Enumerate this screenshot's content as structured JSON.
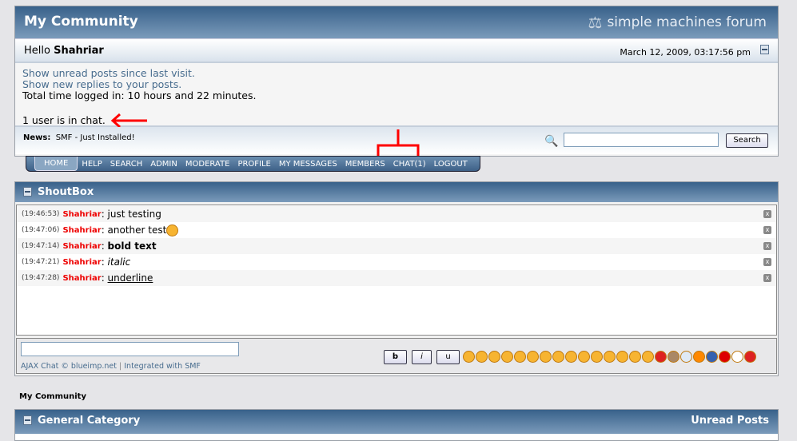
{
  "header": {
    "title": "My Community",
    "logo_text": "simple machines forum",
    "greeting": "Hello",
    "username": "Shahriar",
    "datetime": "March 12, 2009, 03:17:56 pm"
  },
  "info": {
    "unread_link": "Show unread posts since last visit.",
    "replies_link": "Show new replies to your posts.",
    "time_logged": "Total time logged in: 10 hours and 22 minutes.",
    "chat_users": "1 user is in chat."
  },
  "news": {
    "label": "News:",
    "text": "SMF - Just Installed!",
    "search_value": "",
    "search_button": "Search"
  },
  "menu": [
    "HOME",
    "HELP",
    "SEARCH",
    "ADMIN",
    "MODERATE",
    "PROFILE",
    "MY MESSAGES",
    "MEMBERS",
    "CHAT(1)",
    "LOGOUT"
  ],
  "shoutbox": {
    "title": "ShoutBox",
    "messages": [
      {
        "time": "(19:46:53)",
        "user": "Shahriar",
        "text": "just testing",
        "style": "normal"
      },
      {
        "time": "(19:47:06)",
        "user": "Shahriar",
        "text": "another test",
        "style": "normal",
        "smiley": "grin"
      },
      {
        "time": "(19:47:14)",
        "user": "Shahriar",
        "text": "bold text",
        "style": "bold"
      },
      {
        "time": "(19:47:21)",
        "user": "Shahriar",
        "text": "italic",
        "style": "italic"
      },
      {
        "time": "(19:47:28)",
        "user": "Shahriar",
        "text": "underline",
        "style": "underline"
      }
    ],
    "input_value": "",
    "credit_1": "AJAX Chat © blueimp.net",
    "separator": "|",
    "credit_2": "Integrated with SMF",
    "format_buttons": [
      "b",
      "i",
      "u"
    ],
    "smileys": [
      "smile",
      "sad",
      "wink",
      "tongue",
      "grin",
      "neutral",
      "shocked",
      "smirk",
      "glasses",
      "eyes",
      "cool",
      "laugh",
      "cry",
      "angry",
      "angel",
      "devil",
      "monkey",
      "lightbulb",
      "exclamation",
      "question",
      "stop",
      "warning",
      "heart"
    ]
  },
  "board": {
    "label": "My Community",
    "category": "General Category",
    "unread": "Unread Posts"
  },
  "colors": {
    "header": "#38618a",
    "link": "#476c8e",
    "username": "#ee0000",
    "annotation": "#ff0000"
  }
}
